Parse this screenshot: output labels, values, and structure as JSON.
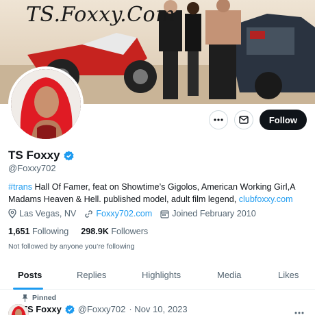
{
  "banner": {
    "text": "TS.Foxxy.Com"
  },
  "profile": {
    "display_name": "TS Foxxy",
    "handle": "@Foxxy702",
    "bio": {
      "hashtag": "#trans",
      "text": " Hall Of Famer, feat on Showtime’s Gigolos, American Working Girl,A Madams Heaven & Hell. published model, adult film legend, ",
      "link": "clubfoxxy.com"
    },
    "location": "Las Vegas, NV",
    "website": "Foxxy702.com",
    "joined": "Joined February 2010",
    "following_count": "1,651",
    "following_label": "Following",
    "followers_count": "298.9K",
    "followers_label": "Followers",
    "not_followed_text": "Not followed by anyone you’re following"
  },
  "actions": {
    "follow_label": "Follow"
  },
  "tabs": [
    {
      "label": "Posts"
    },
    {
      "label": "Replies"
    },
    {
      "label": "Highlights"
    },
    {
      "label": "Media"
    },
    {
      "label": "Likes"
    }
  ],
  "pinned_post": {
    "pinned_label": "Pinned",
    "author_name": "TS Foxxy",
    "author_handle": "@Foxxy702",
    "date": "· Nov 10, 2023"
  },
  "colors": {
    "accent": "#1d9bf0",
    "text": "#0f1419",
    "muted": "#536471"
  }
}
